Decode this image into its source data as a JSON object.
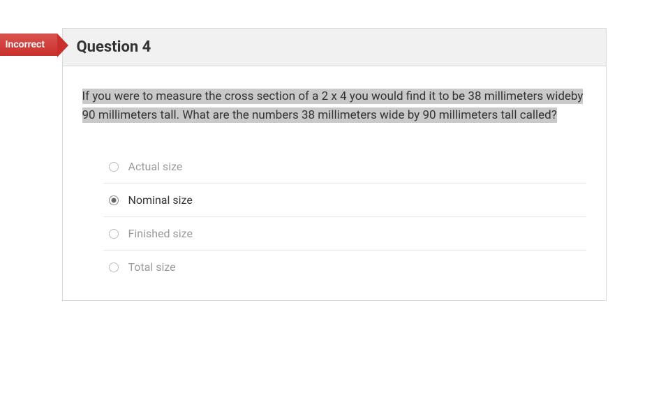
{
  "status": "Incorrect",
  "header": "Question 4",
  "question": "If you were to measure the cross section of a 2 x 4 you would find it to be 38 millimeters wideby 90 millimeters tall. What are the numbers 38 millimeters wide by 90 millimeters tall called?",
  "options": [
    {
      "label": "Actual size",
      "selected": false
    },
    {
      "label": "Nominal size",
      "selected": true
    },
    {
      "label": "Finished size",
      "selected": false
    },
    {
      "label": "Total size",
      "selected": false
    }
  ]
}
